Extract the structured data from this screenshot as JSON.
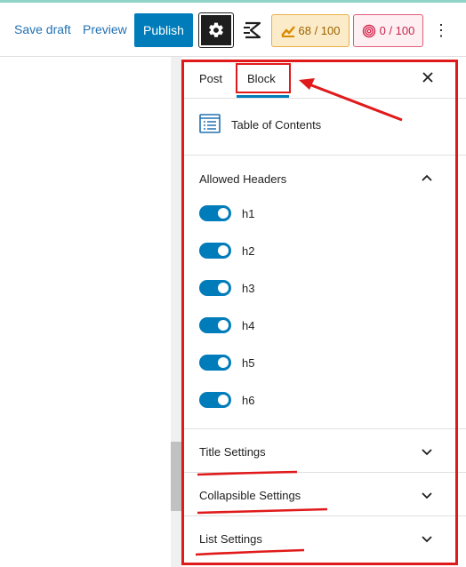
{
  "toolbar": {
    "save_draft": "Save draft",
    "preview": "Preview",
    "publish": "Publish",
    "seo_score": "68 / 100",
    "readability_score": "0 / 100",
    "more": "⋮"
  },
  "sidebar": {
    "tabs": [
      {
        "label": "Post",
        "active": false
      },
      {
        "label": "Block",
        "active": true
      }
    ],
    "block": {
      "name": "Table of Contents",
      "icon": "table-of-contents-icon"
    },
    "allowed_headers": {
      "title": "Allowed Headers",
      "expanded": true,
      "items": [
        {
          "label": "h1",
          "enabled": true
        },
        {
          "label": "h2",
          "enabled": true
        },
        {
          "label": "h3",
          "enabled": true
        },
        {
          "label": "h4",
          "enabled": true
        },
        {
          "label": "h5",
          "enabled": true
        },
        {
          "label": "h6",
          "enabled": true
        }
      ]
    },
    "panels": [
      {
        "title": "Title Settings",
        "expanded": false
      },
      {
        "title": "Collapsible Settings",
        "expanded": false
      },
      {
        "title": "List Settings",
        "expanded": false
      }
    ]
  },
  "colors": {
    "accent": "#007cba",
    "annotation": "#e01a1a",
    "seo_badge": "#fcebc8",
    "readability_badge": "#fdeff2"
  }
}
